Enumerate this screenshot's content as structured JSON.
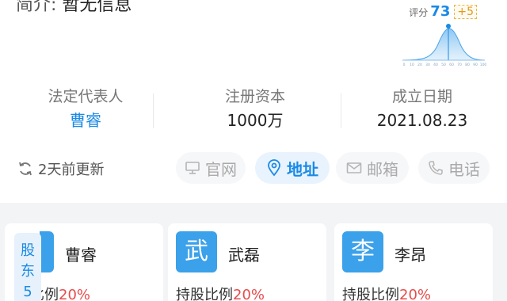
{
  "header": {
    "intro_label": "简介:",
    "intro_value": "暂无信息"
  },
  "score": {
    "label": "评分",
    "value": "73",
    "delta": "+5",
    "axis_ticks": [
      "0",
      "10",
      "20",
      "30",
      "40",
      "50",
      "60",
      "70",
      "80",
      "90",
      "100"
    ]
  },
  "info": {
    "legal_rep_label": "法定代表人",
    "legal_rep_value": "曹睿",
    "capital_label": "注册资本",
    "capital_value": "1000万",
    "founded_label": "成立日期",
    "founded_value": "2021.08.23"
  },
  "actions": {
    "updated_text": "2天前更新",
    "website": "官网",
    "address": "地址",
    "email": "邮箱",
    "phone": "电话"
  },
  "shareholders": {
    "tab_chars": [
      "股",
      "东",
      "5"
    ],
    "cards": [
      {
        "avatar": "",
        "name": "曹睿",
        "ratio_label": "比例",
        "ratio_value": "20%"
      },
      {
        "avatar": "武",
        "name": "武磊",
        "ratio_label": "持股比例",
        "ratio_value": "20%"
      },
      {
        "avatar": "李",
        "name": "李昂",
        "ratio_label": "持股比例",
        "ratio_value": "20%"
      }
    ]
  },
  "colors": {
    "accent": "#1a8ae5",
    "highlight": "#e64c4c",
    "delta": "#e09b1a"
  }
}
